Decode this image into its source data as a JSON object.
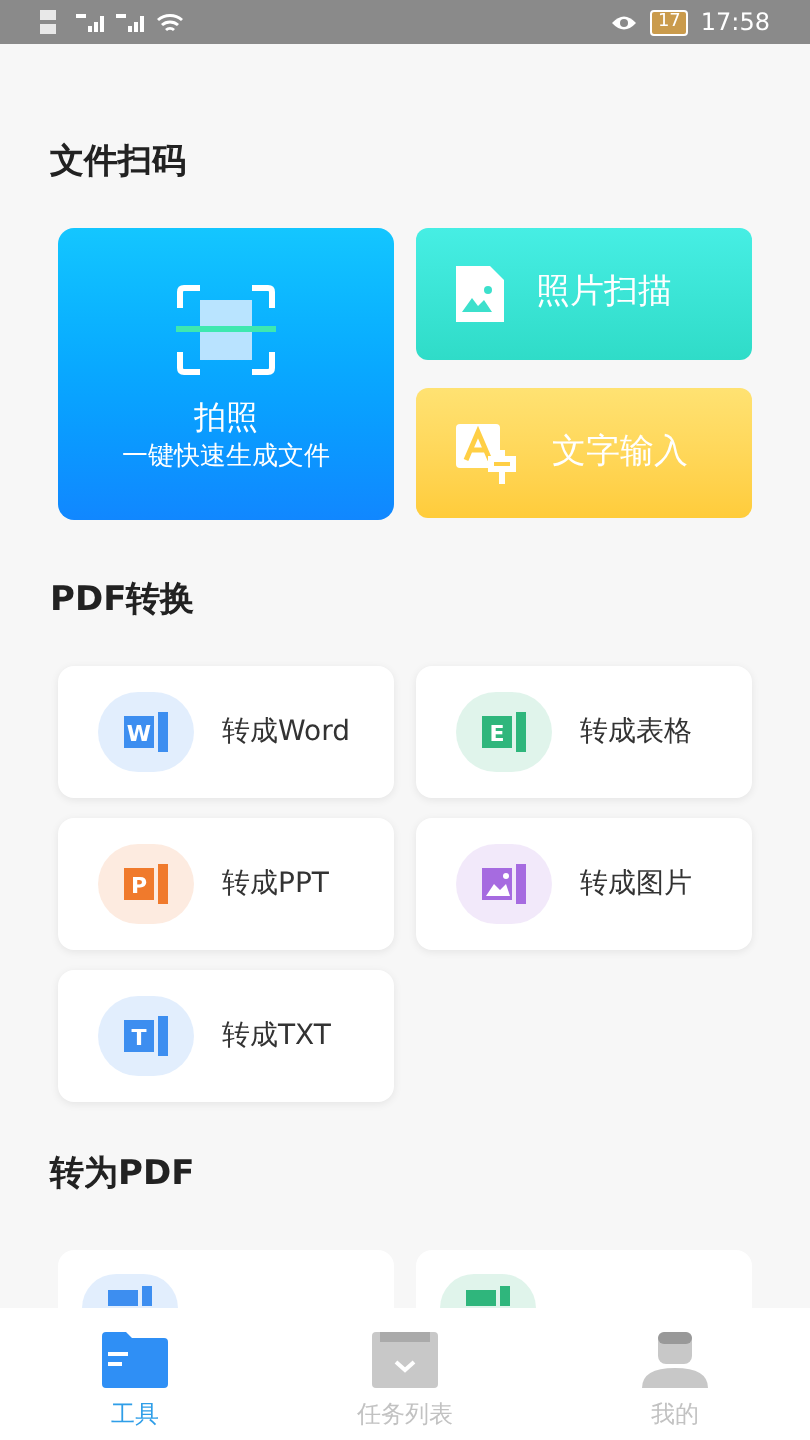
{
  "status_bar": {
    "battery": "17",
    "time": "17:58"
  },
  "scan_section": {
    "title": "文件扫码",
    "main": {
      "label": "拍照",
      "subtitle": "一键快速生成文件"
    },
    "side": [
      {
        "kind": "photo",
        "label": "照片扫描"
      },
      {
        "kind": "text",
        "label": "文字输入"
      }
    ]
  },
  "convert_section": {
    "title": "PDF转换",
    "items": [
      {
        "kind": "doc",
        "letter": "W",
        "label": "转成Word",
        "color": "#3d8ef0"
      },
      {
        "kind": "doc",
        "letter": "E",
        "label": "转成表格",
        "color": "#2fb67c"
      },
      {
        "kind": "doc",
        "letter": "P",
        "label": "转成PPT",
        "color": "#f07a2c"
      },
      {
        "kind": "image",
        "label": "转成图片",
        "color": "#a66be0"
      },
      {
        "kind": "doc",
        "letter": "T",
        "label": "转成TXT",
        "color": "#3d8ef0"
      }
    ]
  },
  "to_pdf_section": {
    "title": "转为PDF",
    "items": [
      {
        "color": "#3d8ef0"
      },
      {
        "color": "#2fb67c"
      }
    ]
  },
  "tabs": [
    {
      "kind": "tools",
      "label": "工具",
      "selected": true
    },
    {
      "kind": "tasks",
      "label": "任务列表",
      "selected": false
    },
    {
      "kind": "me",
      "label": "我的",
      "selected": false
    }
  ]
}
